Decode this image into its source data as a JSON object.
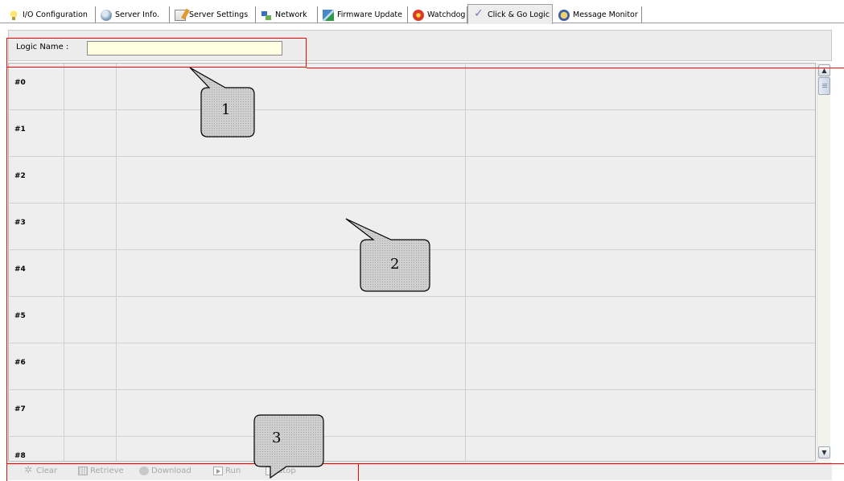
{
  "tabs": [
    {
      "label": "I/O Configuration",
      "icon": "lightbulb-icon",
      "active": false
    },
    {
      "label": "Server Info.",
      "icon": "globe-icon",
      "active": false
    },
    {
      "label": "Server Settings",
      "icon": "notepad-icon",
      "active": false
    },
    {
      "label": "Network",
      "icon": "network-icon",
      "active": false
    },
    {
      "label": "Firmware Update",
      "icon": "firmware-icon",
      "active": false
    },
    {
      "label": "Watchdog",
      "icon": "watchdog-icon",
      "active": false
    },
    {
      "label": "Click & Go Logic",
      "icon": "click-go-icon",
      "active": true
    },
    {
      "label": "Message Monitor",
      "icon": "message-monitor-icon",
      "active": false
    }
  ],
  "logic": {
    "name_label": "Logic Name :",
    "name_value": ""
  },
  "rules": [
    "#0",
    "#1",
    "#2",
    "#3",
    "#4",
    "#5",
    "#6",
    "#7",
    "#8"
  ],
  "toolbar": {
    "clear": "Clear",
    "retrieve": "Retrieve",
    "download": "Download",
    "run": "Run",
    "stop": "Stop"
  },
  "callouts": {
    "one": "1",
    "two": "2",
    "three": "3"
  },
  "colors": {
    "annotation": "#ff0000",
    "name_input_bg": "#ffffe2",
    "panel_bg": "#ececec"
  }
}
